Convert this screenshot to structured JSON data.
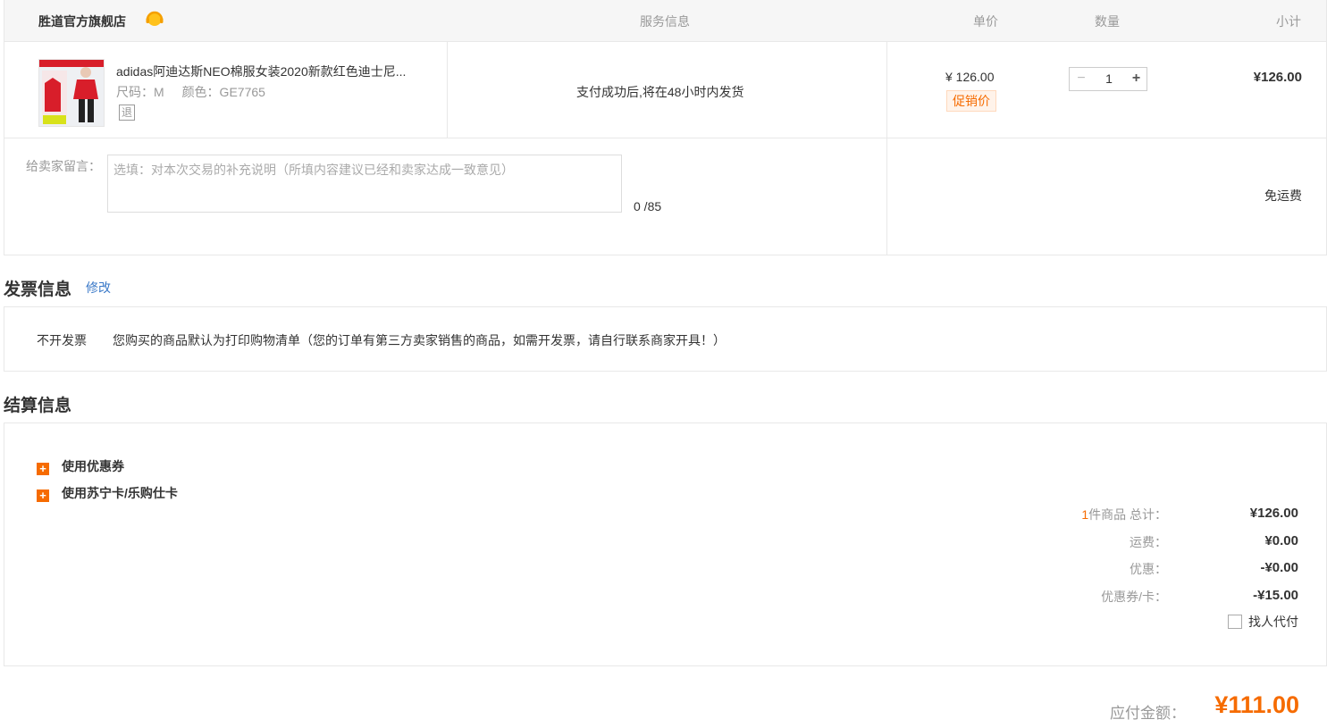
{
  "header": {
    "shop_name": "胜道官方旗舰店",
    "service_icon": "customer-service-icon",
    "col_service": "服务信息",
    "col_price": "单价",
    "col_qty": "数量",
    "col_subtotal": "小计"
  },
  "item": {
    "title": "adidas阿迪达斯NEO棉服女装2020新款红色迪士尼...",
    "size": "尺码：M",
    "color": "颜色：GE7765",
    "return_badge": "退",
    "service": "支付成功后,将在48小时内发货",
    "price": "¥ 126.00",
    "promo_tag": "促销价",
    "qty_minus": "−",
    "qty": "1",
    "qty_plus": "+",
    "subtotal": "¥126.00"
  },
  "message": {
    "label": "给卖家留言：",
    "placeholder": "选填：对本次交易的补充说明（所填内容建议已经和卖家达成一致意见）",
    "value": "",
    "count": "0 /85"
  },
  "shipping": "免运费",
  "invoice": {
    "title": "发票信息",
    "edit": "修改",
    "type": "不开发票",
    "desc": "您购买的商品默认为打印购物清单（您的订单有第三方卖家销售的商品，如需开发票，请自行联系商家开具！）"
  },
  "settlement": {
    "title": "结算信息",
    "coupon_option": "使用优惠券",
    "card_option": "使用苏宁卡/乐购仕卡",
    "count": "1",
    "count_label": "件商品 总计：",
    "total": "¥126.00",
    "freight_label": "运费：",
    "freight": "¥0.00",
    "discount_label": "优惠：",
    "discount": "-¥0.00",
    "coupon_label": "优惠券/卡：",
    "coupon": "-¥15.00",
    "proxy_pay": "找人代付",
    "payable_label": "应付金额：",
    "payable": "¥111.00"
  },
  "colors": {
    "accent": "#f66b00",
    "link": "#3a79c8",
    "border": "#e8e8e8",
    "header_bg": "#f6f6f6"
  }
}
